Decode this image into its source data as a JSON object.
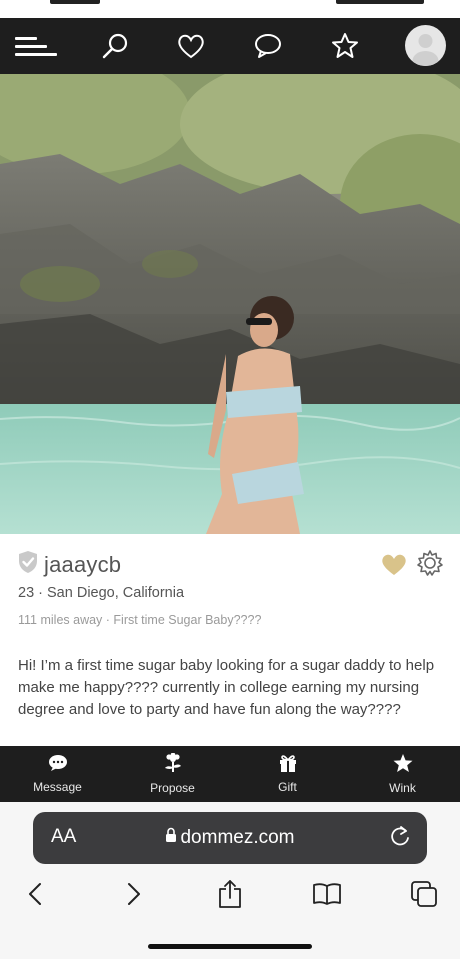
{
  "topnav": {
    "menu_icon": "hamburger-menu-icon",
    "search_icon": "search-icon",
    "favorites_icon": "heart-icon",
    "messages_icon": "chat-bubble-icon",
    "featured_icon": "star-icon",
    "avatar_icon": "user-avatar-icon"
  },
  "profile": {
    "username": "jaaaycb",
    "verified_icon": "shield-check-icon",
    "age_location": "23 · San Diego, California",
    "meta": "111 miles away · First time Sugar Baby????",
    "bio": "Hi! I’m a first time sugar baby looking for a sugar daddy to help make me happy???? currently in college earning my nursing degree and love to party and have fun along the way????",
    "favorite_color": "#d9c38a",
    "settings_icon": "gear-icon"
  },
  "actions": [
    {
      "label": "Message",
      "icon": "message-icon"
    },
    {
      "label": "Propose",
      "icon": "flower-icon"
    },
    {
      "label": "Gift",
      "icon": "gift-icon"
    },
    {
      "label": "Wink",
      "icon": "star-icon"
    }
  ],
  "browser": {
    "text_size_label": "AA",
    "url": "dommez.com",
    "lock_icon": "lock-icon",
    "reload_icon": "reload-icon",
    "toolbar": [
      "back-icon",
      "forward-icon",
      "share-icon",
      "bookmarks-icon",
      "tabs-icon"
    ]
  },
  "colors": {
    "nav_bg": "#1e1e1e",
    "urlbar_bg": "#3c3c3e"
  }
}
